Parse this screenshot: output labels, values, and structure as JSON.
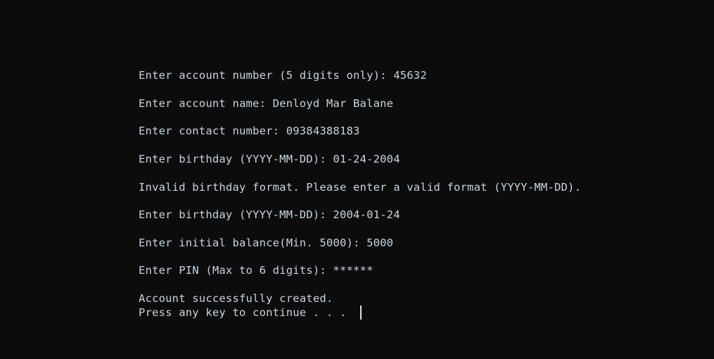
{
  "terminal": {
    "lines": [
      "Enter account number (5 digits only): 45632",
      "Enter account name: Denloyd Mar Balane",
      "Enter contact number: 09384388183",
      "Enter birthday (YYYY-MM-DD): 01-24-2004",
      "Invalid birthday format. Please enter a valid format (YYYY-MM-DD).",
      "Enter birthday (YYYY-MM-DD): 2004-01-24",
      "Enter initial balance(Min. 5000): 5000",
      "Enter PIN (Max to 6 digits): ******",
      "Account successfully created.",
      "Press any key to continue . . . "
    ]
  },
  "colors": {
    "background": "#0c0c0c",
    "text": "#c8d4de"
  }
}
